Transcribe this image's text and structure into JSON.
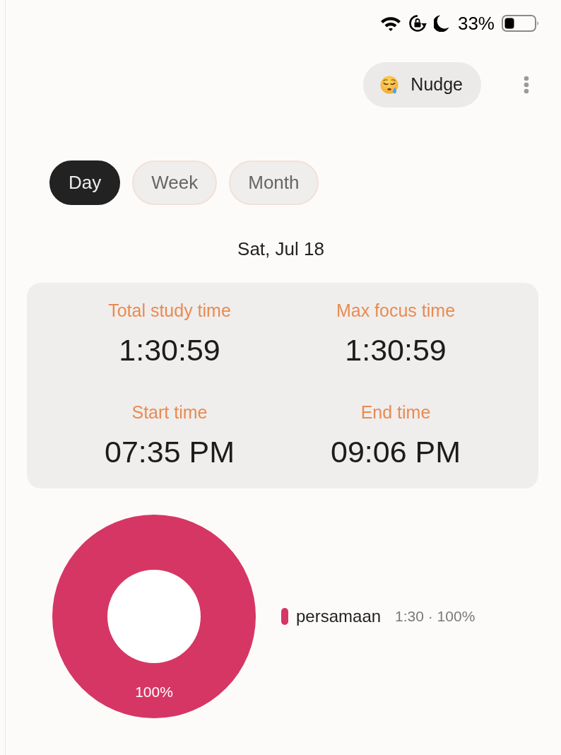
{
  "status_bar": {
    "battery": "33%"
  },
  "header": {
    "nudge_button": "Nudge"
  },
  "tabs": [
    {
      "label": "Day",
      "selected": true
    },
    {
      "label": "Week",
      "selected": false
    },
    {
      "label": "Month",
      "selected": false
    }
  ],
  "date": "Sat, Jul 18",
  "stats": [
    {
      "label": "Total study time",
      "value": "1:30:59"
    },
    {
      "label": "Max focus time",
      "value": "1:30:59"
    },
    {
      "label": "Start time",
      "value": "07:35 PM"
    },
    {
      "label": "End time",
      "value": "09:06 PM"
    }
  ],
  "breakdown": {
    "chart_data": {
      "type": "donut",
      "categories": [
        "persamaan"
      ],
      "values": [
        100
      ],
      "value_labels": [
        "100%"
      ]
    },
    "legend": [
      {
        "color": "#d63663",
        "detail": "1:30 · 100%"
      }
    ]
  }
}
